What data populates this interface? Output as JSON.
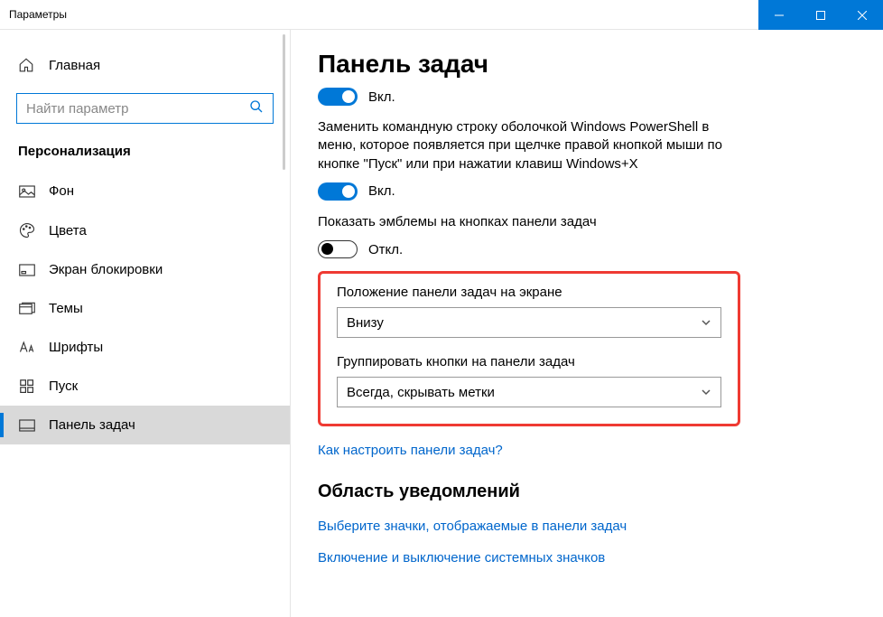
{
  "window": {
    "title": "Параметры"
  },
  "sidebar": {
    "home": "Главная",
    "search_placeholder": "Найти параметр",
    "category": "Персонализация",
    "items": [
      {
        "label": "Фон"
      },
      {
        "label": "Цвета"
      },
      {
        "label": "Экран блокировки"
      },
      {
        "label": "Темы"
      },
      {
        "label": "Шрифты"
      },
      {
        "label": "Пуск"
      },
      {
        "label": "Панель задач"
      }
    ]
  },
  "content": {
    "heading": "Панель задач",
    "toggle1_state": "Вкл.",
    "desc1": "Заменить командную строку оболочкой Windows PowerShell в меню, которое появляется при щелчке правой кнопкой мыши по кнопке \"Пуск\" или при нажатии клавиш Windows+X",
    "toggle2_state": "Вкл.",
    "desc2": "Показать эмблемы на кнопках панели задач",
    "toggle3_state": "Откл.",
    "position_label": "Положение панели задач на экране",
    "position_value": "Внизу",
    "group_label": "Группировать кнопки на панели задач",
    "group_value": "Всегда, скрывать метки",
    "help_link": "Как настроить панели задач?",
    "subheading": "Область уведомлений",
    "link_icons": "Выберите значки, отображаемые в панели задач",
    "link_system": "Включение и выключение системных значков"
  }
}
